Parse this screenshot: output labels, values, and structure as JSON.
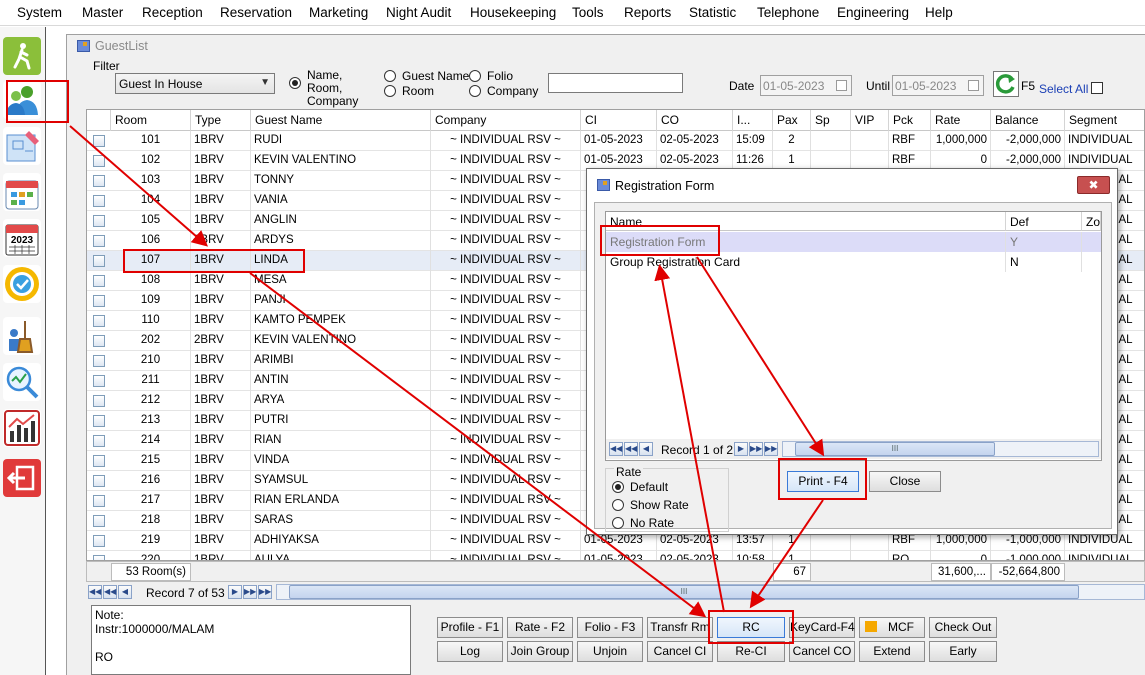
{
  "menu": [
    "System",
    "Master",
    "Reception",
    "Reservation",
    "Marketing",
    "Night Audit",
    "Housekeeping",
    "Tools",
    "Reports",
    "Statistic",
    "Telephone",
    "Engineering",
    "Help"
  ],
  "window": {
    "title": "GuestList"
  },
  "filter": {
    "label": "Filter",
    "selected": "Guest In House",
    "search_by": [
      "Name, Room, Company",
      "Guest Name",
      "Room",
      "Folio",
      "Company"
    ],
    "search_value": "",
    "date_label": "Date",
    "date_value": "01-05-2023",
    "until_label": "Until",
    "until_value": "01-05-2023",
    "refresh_key": "F5",
    "select_all_label": "Select All"
  },
  "grid": {
    "columns": [
      "Room",
      "Type",
      "Guest Name",
      "Company",
      "CI",
      "CO",
      "I...",
      "Pax",
      "Sp",
      "VIP",
      "Pck",
      "Rate",
      "Balance",
      "Segment"
    ],
    "rows": [
      {
        "room": "101",
        "type": "1BRV",
        "guest": "RUDI",
        "company": "~ INDIVIDUAL RSV ~",
        "ci": "01-05-2023",
        "co": "02-05-2023",
        "time": "15:09",
        "pax": "2",
        "pck": "RBF",
        "rate": "1,000,000",
        "balance": "-2,000,000",
        "segment": "INDIVIDUAL"
      },
      {
        "room": "102",
        "type": "1BRV",
        "guest": "KEVIN VALENTINO",
        "company": "~ INDIVIDUAL RSV ~",
        "ci": "01-05-2023",
        "co": "02-05-2023",
        "time": "11:26",
        "pax": "1",
        "pck": "RBF",
        "rate": "0",
        "balance": "-2,000,000",
        "segment": "INDIVIDUAL"
      },
      {
        "room": "103",
        "type": "1BRV",
        "guest": "TONNY",
        "company": "~ INDIVIDUAL RSV ~",
        "ci": "",
        "co": "",
        "time": "",
        "pax": "",
        "pck": "",
        "rate": "",
        "balance": "",
        "segment": "INDIVIDUAL"
      },
      {
        "room": "104",
        "type": "1BRV",
        "guest": "VANIA",
        "company": "~ INDIVIDUAL RSV ~",
        "ci": "",
        "co": "",
        "time": "",
        "pax": "",
        "pck": "",
        "rate": "",
        "balance": "",
        "segment": "INDIVIDUAL"
      },
      {
        "room": "105",
        "type": "1BRV",
        "guest": "ANGLIN",
        "company": "~ INDIVIDUAL RSV ~",
        "ci": "",
        "co": "",
        "time": "",
        "pax": "",
        "pck": "",
        "rate": "",
        "balance": "",
        "segment": "INDIVIDUAL"
      },
      {
        "room": "106",
        "type": "1BRV",
        "guest": "ARDYS",
        "company": "~ INDIVIDUAL RSV ~",
        "ci": "",
        "co": "",
        "time": "",
        "pax": "",
        "pck": "",
        "rate": "",
        "balance": "",
        "segment": "INDIVIDUAL"
      },
      {
        "room": "107",
        "type": "1BRV",
        "guest": "LINDA",
        "company": "~ INDIVIDUAL RSV ~",
        "ci": "",
        "co": "",
        "time": "",
        "pax": "",
        "pck": "",
        "rate": "",
        "balance": "",
        "segment": "INDIVIDUAL"
      },
      {
        "room": "108",
        "type": "1BRV",
        "guest": "MESA",
        "company": "~ INDIVIDUAL RSV ~",
        "ci": "",
        "co": "",
        "time": "",
        "pax": "",
        "pck": "",
        "rate": "",
        "balance": "",
        "segment": "INDIVIDUAL"
      },
      {
        "room": "109",
        "type": "1BRV",
        "guest": "PANJI",
        "company": "~ INDIVIDUAL RSV ~",
        "ci": "",
        "co": "",
        "time": "",
        "pax": "",
        "pck": "",
        "rate": "",
        "balance": "",
        "segment": "INDIVIDUAL"
      },
      {
        "room": "110",
        "type": "1BRV",
        "guest": "KAMTO PEMPEK",
        "company": "~ INDIVIDUAL RSV ~",
        "ci": "",
        "co": "",
        "time": "",
        "pax": "",
        "pck": "",
        "rate": "",
        "balance": "",
        "segment": "INDIVIDUAL"
      },
      {
        "room": "202",
        "type": "2BRV",
        "guest": "KEVIN VALENTINO",
        "company": "~ INDIVIDUAL RSV ~",
        "ci": "",
        "co": "",
        "time": "",
        "pax": "",
        "pck": "",
        "rate": "",
        "balance": "",
        "segment": "INDIVIDUAL"
      },
      {
        "room": "210",
        "type": "1BRV",
        "guest": "ARIMBI",
        "company": "~ INDIVIDUAL RSV ~",
        "ci": "",
        "co": "",
        "time": "",
        "pax": "",
        "pck": "",
        "rate": "",
        "balance": "",
        "segment": "INDIVIDUAL"
      },
      {
        "room": "211",
        "type": "1BRV",
        "guest": "ANTIN",
        "company": "~ INDIVIDUAL RSV ~",
        "ci": "",
        "co": "",
        "time": "",
        "pax": "",
        "pck": "",
        "rate": "",
        "balance": "",
        "segment": "INDIVIDUAL"
      },
      {
        "room": "212",
        "type": "1BRV",
        "guest": "ARYA",
        "company": "~ INDIVIDUAL RSV ~",
        "ci": "",
        "co": "",
        "time": "",
        "pax": "",
        "pck": "",
        "rate": "",
        "balance": "",
        "segment": "INDIVIDUAL"
      },
      {
        "room": "213",
        "type": "1BRV",
        "guest": "PUTRI",
        "company": "~ INDIVIDUAL RSV ~",
        "ci": "",
        "co": "",
        "time": "",
        "pax": "",
        "pck": "",
        "rate": "",
        "balance": "",
        "segment": "INDIVIDUAL"
      },
      {
        "room": "214",
        "type": "1BRV",
        "guest": "RIAN",
        "company": "~ INDIVIDUAL RSV ~",
        "ci": "",
        "co": "",
        "time": "",
        "pax": "",
        "pck": "",
        "rate": "",
        "balance": "",
        "segment": "INDIVIDUAL"
      },
      {
        "room": "215",
        "type": "1BRV",
        "guest": "VINDA",
        "company": "~ INDIVIDUAL RSV ~",
        "ci": "",
        "co": "",
        "time": "",
        "pax": "",
        "pck": "",
        "rate": "",
        "balance": "",
        "segment": "INDIVIDUAL"
      },
      {
        "room": "216",
        "type": "1BRV",
        "guest": "SYAMSUL",
        "company": "~ INDIVIDUAL RSV ~",
        "ci": "",
        "co": "",
        "time": "",
        "pax": "",
        "pck": "",
        "rate": "",
        "balance": "",
        "segment": "INDIVIDUAL"
      },
      {
        "room": "217",
        "type": "1BRV",
        "guest": "RIAN ERLANDA",
        "company": "~ INDIVIDUAL RSV ~",
        "ci": "",
        "co": "",
        "time": "",
        "pax": "",
        "pck": "",
        "rate": "",
        "balance": "",
        "segment": "INDIVIDUAL"
      },
      {
        "room": "218",
        "type": "1BRV",
        "guest": "SARAS",
        "company": "~ INDIVIDUAL RSV ~",
        "ci": "",
        "co": "",
        "time": "",
        "pax": "",
        "pck": "",
        "rate": "",
        "balance": "",
        "segment": "INDIVIDUAL"
      },
      {
        "room": "219",
        "type": "1BRV",
        "guest": "ADHIYAKSA",
        "company": "~ INDIVIDUAL RSV ~",
        "ci": "01-05-2023",
        "co": "02-05-2023",
        "time": "13:57",
        "pax": "1",
        "pck": "RBF",
        "rate": "1,000,000",
        "balance": "-1,000,000",
        "segment": "INDIVIDUAL"
      },
      {
        "room": "220",
        "type": "1BRV",
        "guest": "AULYA",
        "company": "~ INDIVIDUAL RSV ~",
        "ci": "01-05-2023",
        "co": "02-05-2023",
        "time": "10:58",
        "pax": "1",
        "pck": "RO",
        "rate": "0",
        "balance": "-1,000,000",
        "segment": "INDIVIDUAL"
      }
    ],
    "footer": {
      "rooms": "53 Room(s)",
      "pax_total": "67",
      "rate_total": "31,600,...",
      "balance_total": "-52,664,800"
    },
    "record": "Record 7 of 53"
  },
  "note": {
    "label": "Note:",
    "lines": [
      "Instr:1000000/MALAM",
      "",
      "RO"
    ]
  },
  "buttons": {
    "row1": [
      "Profile - F1",
      "Rate - F2",
      "Folio - F3",
      "Transfr Rm",
      "RC",
      "KeyCard-F4",
      "MCF",
      "Check Out"
    ],
    "row2": [
      "Log",
      "Join Group",
      "Unjoin",
      "Cancel CI",
      "Re-CI",
      "Cancel CO",
      "Extend",
      "Early"
    ]
  },
  "dialog": {
    "title": "Registration Form",
    "columns": [
      "Name",
      "Def",
      "Zoo"
    ],
    "rows": [
      {
        "name": "Registration Form",
        "def": "Y"
      },
      {
        "name": "Group Registration Card",
        "def": "N"
      }
    ],
    "record": "Record 1 of 2",
    "rate_label": "Rate",
    "rate_options": [
      "Default",
      "Show Rate",
      "No Rate"
    ],
    "print_label": "Print - F4",
    "close_label": "Close"
  },
  "colors": {
    "annotation_red": "#e00000",
    "selected_row": "#e6ecf6",
    "link_blue": "#1a3fb5"
  }
}
